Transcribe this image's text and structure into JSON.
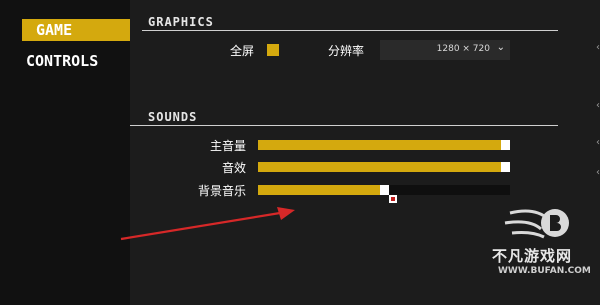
{
  "sidebar": {
    "items": [
      {
        "label": "GAME",
        "active": true
      },
      {
        "label": "CONTROLS",
        "active": false
      }
    ]
  },
  "graphics": {
    "title": "GRAPHICS",
    "fullscreen_label": "全屏",
    "fullscreen_checked": true,
    "resolution_label": "分辨率",
    "resolution_value": "1280 × 720"
  },
  "sounds": {
    "title": "SOUNDS",
    "sliders": [
      {
        "label": "主音量",
        "level": 1.0
      },
      {
        "label": "音效",
        "level": 1.0
      },
      {
        "label": "背景音乐",
        "level": 0.5
      }
    ]
  },
  "watermark": {
    "text": "不凡游戏网",
    "url": "WWW.BUFAN.COM"
  },
  "colors": {
    "accent": "#d4a90e",
    "arrow": "#d62828"
  }
}
